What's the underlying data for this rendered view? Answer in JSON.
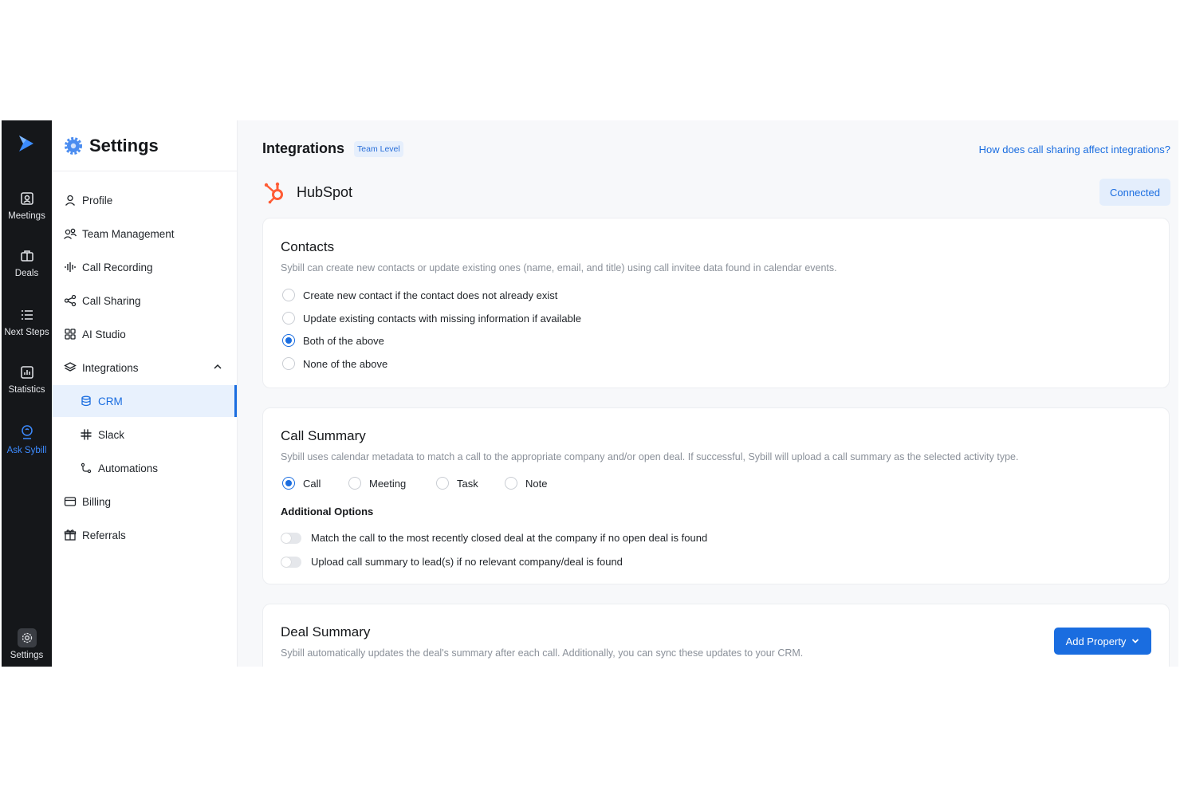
{
  "rail": {
    "items": [
      {
        "label": "Meetings",
        "icon": "meetings-icon"
      },
      {
        "label": "Deals",
        "icon": "briefcase-icon"
      },
      {
        "label": "Next Steps",
        "icon": "list-icon"
      },
      {
        "label": "Statistics",
        "icon": "chart-icon"
      },
      {
        "label": "Ask Sybill",
        "icon": "ask-sybill-icon",
        "active": true
      }
    ],
    "settings_label": "Settings"
  },
  "sidebar": {
    "title": "Settings",
    "items": [
      {
        "label": "Profile",
        "icon": "user-icon"
      },
      {
        "label": "Team Management",
        "icon": "team-icon"
      },
      {
        "label": "Call Recording",
        "icon": "waveform-icon"
      },
      {
        "label": "Call Sharing",
        "icon": "share-icon"
      },
      {
        "label": "AI Studio",
        "icon": "grid-icon"
      },
      {
        "label": "Integrations",
        "icon": "layers-icon",
        "expanded": true
      },
      {
        "label": "CRM",
        "icon": "database-icon",
        "active": true
      },
      {
        "label": "Slack",
        "icon": "slack-icon"
      },
      {
        "label": "Automations",
        "icon": "automation-icon"
      },
      {
        "label": "Billing",
        "icon": "card-icon"
      },
      {
        "label": "Referrals",
        "icon": "gift-icon"
      }
    ]
  },
  "main": {
    "title": "Integrations",
    "badge": "Team Level",
    "help_link": "How does call sharing affect integrations?",
    "integration_name": "HubSpot",
    "status": "Connected",
    "accent": "#1a6de0",
    "hubspot_color": "#ff5c35",
    "contacts": {
      "title": "Contacts",
      "description": "Sybill can create new contacts or update existing ones (name, email, and title) using call invitee data found in calendar events.",
      "options": [
        {
          "label": "Create new contact if the contact does not already exist",
          "selected": false
        },
        {
          "label": "Update existing contacts with missing information if available",
          "selected": false
        },
        {
          "label": "Both of the above",
          "selected": true
        },
        {
          "label": "None of the above",
          "selected": false
        }
      ]
    },
    "call_summary": {
      "title": "Call Summary",
      "description": "Sybill uses calendar metadata to match a call to the appropriate company and/or open deal. If successful, Sybill will upload a call summary as the selected activity type.",
      "types": [
        {
          "label": "Call",
          "selected": true
        },
        {
          "label": "Meeting",
          "selected": false
        },
        {
          "label": "Task",
          "selected": false
        },
        {
          "label": "Note",
          "selected": false
        }
      ],
      "additional_title": "Additional Options",
      "toggles": [
        {
          "label": "Match the call to the most recently closed deal at the company if no open deal is found",
          "on": false
        },
        {
          "label": "Upload call summary to lead(s) if no relevant company/deal is found",
          "on": false
        }
      ]
    },
    "deal_summary": {
      "title": "Deal Summary",
      "description": "Sybill automatically updates the deal's summary after each call. Additionally, you can sync these updates to your CRM.",
      "button": "Add Property"
    }
  }
}
